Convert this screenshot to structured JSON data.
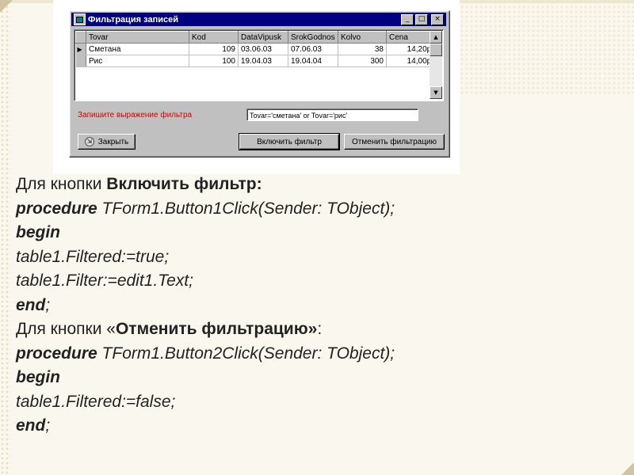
{
  "window": {
    "title": "Фильтрация записей",
    "buttons": [
      "_",
      "□",
      "×"
    ]
  },
  "grid": {
    "columns": [
      "Tovar",
      "Kod",
      "DataVipusk",
      "SrokGodnos",
      "Kolvo",
      "Cena"
    ],
    "rows": [
      {
        "indicator": "▶",
        "cells": [
          "Сметана",
          "109",
          "03.06.03",
          "07.06.03",
          "38",
          "14,20р."
        ]
      },
      {
        "indicator": "",
        "cells": [
          "Рис",
          "100",
          "19.04.03",
          "19.04.04",
          "300",
          "14,00р."
        ]
      }
    ]
  },
  "filter": {
    "label": "Запишите выражение фильтра",
    "value": "Tovar='сметана' or Tovar='рис'"
  },
  "buttons": {
    "close": "Закрыть",
    "apply": "Включить фильтр",
    "cancel": "Отменить фильтрацию"
  },
  "slide": {
    "l1a": "Для кнопки ",
    "l1b": "Включить фильтр:",
    "l2a": "procedure",
    "l2b": " TForm1.Button1Click(Sender: TObject);",
    "l3": "begin",
    "l4": "table1.Filtered:=true;",
    "l5": "table1.Filter:=edit1.Text;",
    "l6a": "end",
    "l6b": ";",
    "l7a": "Для кнопки «",
    "l7b": "Отменить фильтрацию»",
    "l7c": ":",
    "l8a": "procedure",
    "l8b": " TForm1.Button2Click(Sender: TObject);",
    "l9": "begin",
    "l10": "table1.Filtered:=false;",
    "l11a": "end",
    "l11b": ";"
  },
  "colors": {
    "titlebar": "#000080",
    "window_face": "#c0c0c0",
    "filter_label": "#d40000",
    "slide_background": "#faf8ee"
  }
}
